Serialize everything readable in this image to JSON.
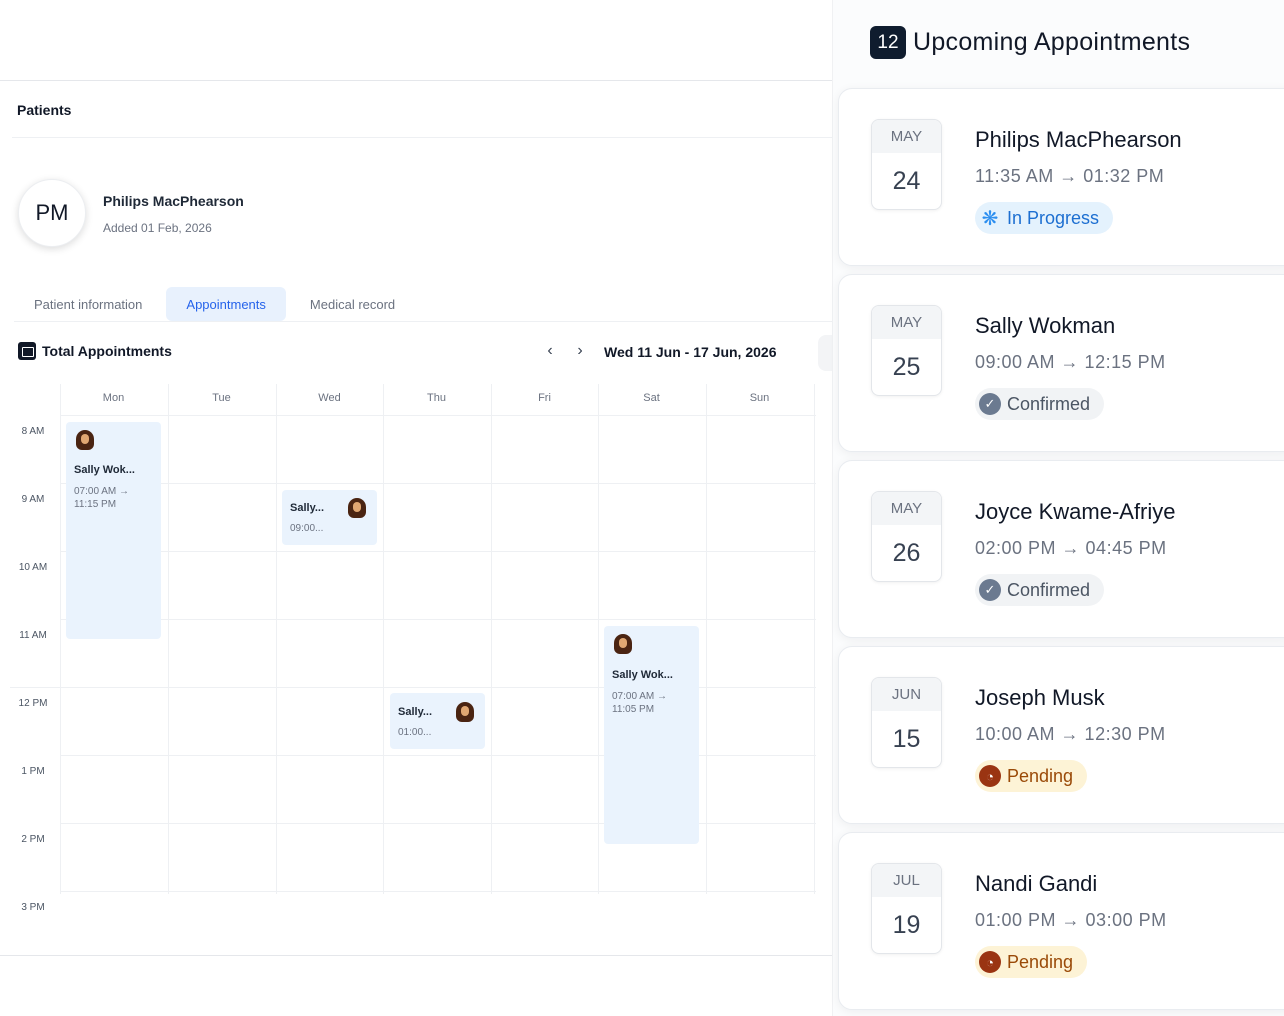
{
  "patient_panel": {
    "title": "Patients",
    "patient": {
      "initials": "PM",
      "name": "Philips MacPhearson",
      "added": "Added 01 Feb, 2026"
    },
    "tabs": [
      {
        "label": "Patient information",
        "active": false
      },
      {
        "label": "Appointments",
        "active": true
      },
      {
        "label": "Medical record",
        "active": false
      }
    ],
    "appointments_title": "Total Appointments",
    "date_range": "Wed 11 Jun - 17 Jun, 2026",
    "prev_icon": "chevron-left-icon",
    "next_icon": "chevron-right-icon",
    "days": [
      "Mon",
      "Tue",
      "Wed",
      "Thu",
      "Fri",
      "Sat",
      "Sun"
    ],
    "times": [
      "8 AM",
      "9 AM",
      "10 AM",
      "11 AM",
      "12 PM",
      "1 PM",
      "2 PM",
      "3 PM"
    ],
    "events": [
      {
        "name": "Sally Wok...",
        "time": "07:00 AM → 11:15 PM"
      },
      {
        "name": "Sally...",
        "time": "09:00..."
      },
      {
        "name": "Sally...",
        "time": "01:00..."
      },
      {
        "name": "Sally Wok...",
        "time": "07:00 AM → 11:05 PM"
      }
    ]
  },
  "upcoming": {
    "count": "12",
    "title": "Upcoming Appointments",
    "cards": [
      {
        "month": "MAY",
        "day": "24",
        "name": "Philips MacPhearson",
        "time": "11:35 AM → 01:32 PM",
        "status": "In Progress",
        "status_type": "in-progress"
      },
      {
        "month": "MAY",
        "day": "25",
        "name": "Sally Wokman",
        "time": "09:00 AM → 12:15 PM",
        "status": "Confirmed",
        "status_type": "confirmed"
      },
      {
        "month": "MAY",
        "day": "26",
        "name": "Joyce Kwame-Afriye",
        "time": "02:00 PM → 04:45 PM",
        "status": "Confirmed",
        "status_type": "confirmed"
      },
      {
        "month": "JUN",
        "day": "15",
        "name": "Joseph Musk",
        "time": "10:00 AM → 12:30 PM",
        "status": "Pending",
        "status_type": "pending"
      },
      {
        "month": "JUL",
        "day": "19",
        "name": "Nandi Gandi",
        "time": "01:00 PM → 03:00 PM",
        "status": "Pending",
        "status_type": "pending"
      }
    ]
  },
  "colors": {
    "accent": "#2563eb",
    "event_bg": "#eaf3fd",
    "badge_dark": "#0f1c2e",
    "in_progress": "#1d6fd1",
    "confirmed": "#6b7a90",
    "pending": "#9a3412"
  }
}
